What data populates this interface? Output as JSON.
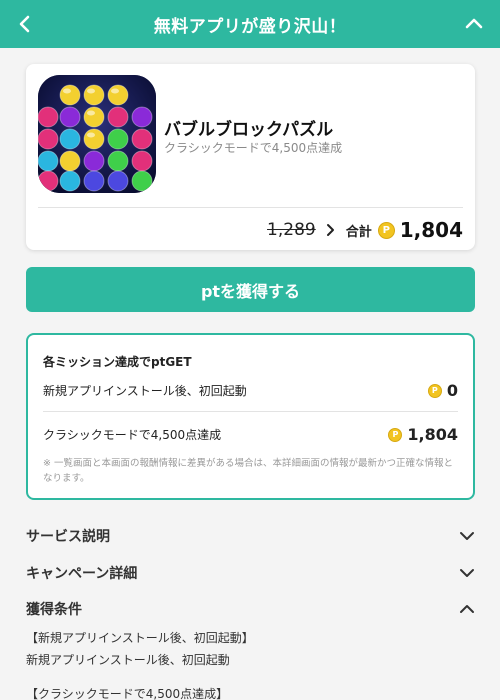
{
  "header": {
    "title": "無料アプリが盛り沢山！",
    "back_icon": "chevron-left-icon",
    "collapse_icon": "chevron-up-icon",
    "color": "#2eb8a0"
  },
  "app": {
    "name": "バブルブロックパズル",
    "subtitle": "クラシックモードで4,500点達成",
    "old_price": "1,289",
    "total_label": "合計",
    "coin_symbol": "P",
    "total_price": "1,804"
  },
  "cta": {
    "label": "ptを獲得する"
  },
  "missions": {
    "title": "各ミッション達成でptGET",
    "items": [
      {
        "label": "新規アプリインストール後、初回起動",
        "points": "0"
      },
      {
        "label": "クラシックモードで4,500点達成",
        "points": "1,804"
      }
    ],
    "note": "※ 一覧画面と本画面の報酬情報に差異がある場合は、本詳細画面の情報が最新かつ正確な情報となります。"
  },
  "sections": {
    "service": "サービス説明",
    "campaign": "キャンペーン詳細",
    "conditions": "獲得条件"
  },
  "conditions": {
    "items": [
      "【新規アプリインストール後、初回起動】",
      "新規アプリインストール後、初回起動",
      "【クラシックモードで4,500点達成】"
    ]
  }
}
